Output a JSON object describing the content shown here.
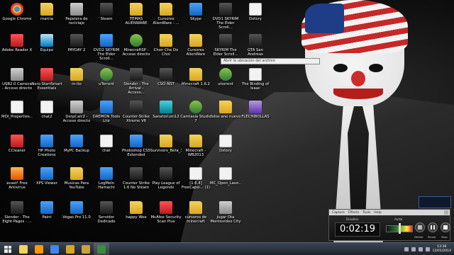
{
  "desktop": {
    "icons": [
      {
        "label": "Google Chrome",
        "icon": "chrome-icon",
        "type": "g-chrome"
      },
      {
        "label": "marcia",
        "icon": "folder-icon",
        "type": "g-folder"
      },
      {
        "label": "Papelera de reciclaje",
        "icon": "recycle-bin-icon",
        "type": "g-gray"
      },
      {
        "label": "Steam",
        "icon": "steam-icon",
        "type": "g-dark"
      },
      {
        "label": "TEMAS ALIENWARE",
        "icon": "folder-icon",
        "type": "g-folder"
      },
      {
        "label": "Cursores AlienWare - ...",
        "icon": "folder-icon",
        "type": "g-folder"
      },
      {
        "label": "Skype",
        "icon": "skype-icon",
        "type": "g-blue"
      },
      {
        "label": "DVD1 SKYRIM The Elder Scroll...",
        "icon": "skyrim-icon",
        "type": "g-dark"
      },
      {
        "label": "Dxtory",
        "icon": "document-icon",
        "type": "g-doc"
      },
      {
        "label": "Adobe Reader X",
        "icon": "adobe-reader-icon",
        "type": "g-red"
      },
      {
        "label": "Equipo",
        "icon": "computer-icon",
        "type": "g-pc"
      },
      {
        "label": "PAYDAY 2",
        "icon": "payday-icon",
        "type": "g-dark"
      },
      {
        "label": "DVD2 SKYRIM The Elder Scroll...",
        "icon": "skyrim-icon",
        "type": "g-blue"
      },
      {
        "label": "MinecraftSP - Acceso directo",
        "icon": "minecraft-icon",
        "type": "g-green"
      },
      {
        "label": "Chon Che Do Choi",
        "icon": "folder-icon",
        "type": "g-folder"
      },
      {
        "label": "Cursores AlienWare",
        "icon": "folder-icon",
        "type": "g-folder"
      },
      {
        "label": "SKYRIM The Elder Scroll...",
        "icon": "skyrim-icon",
        "type": "g-dark"
      },
      {
        "label": "GTA San Andreas",
        "icon": "gta-icon",
        "type": "g-dark"
      },
      {
        "label": "USB2.0 Camera - Acceso directo",
        "icon": "camera-icon",
        "type": "g-gray"
      },
      {
        "label": "Nero StartSmart Essentials",
        "icon": "nero-icon",
        "type": "g-red"
      },
      {
        "label": "m-ito",
        "icon": "folder-icon",
        "type": "g-folder"
      },
      {
        "label": "uTorrent",
        "icon": "utorrent-icon",
        "type": "g-green"
      },
      {
        "label": "Slender - The Arrival - Acceso...",
        "icon": "slender-icon",
        "type": "g-dark"
      },
      {
        "label": "CSO-NST",
        "icon": "counter-strike-icon",
        "type": "g-dark"
      },
      {
        "label": "Minecraft 1.6.2",
        "icon": "folder-icon",
        "type": "g-folder"
      },
      {
        "label": "utorrent",
        "icon": "utorrent-icon",
        "type": "g-green"
      },
      {
        "label": "The Binding of Isaac",
        "icon": "document-icon",
        "type": "g-doc"
      },
      {
        "label": "MOI_Properties...",
        "icon": "document-icon",
        "type": "g-doc"
      },
      {
        "label": "chat2",
        "icon": "document-icon",
        "type": "g-doc"
      },
      {
        "label": "DerpCalc2 - Acceso directo",
        "icon": "derp-icon",
        "type": "g-gray"
      },
      {
        "label": "DAEMON Tools Lite",
        "icon": "daemon-tools-icon",
        "type": "g-blue"
      },
      {
        "label": "Counter-Strike Xtreme V6",
        "icon": "counter-strike-icon",
        "type": "g-dark"
      },
      {
        "label": "Sanatorium12",
        "icon": "sanatorium-icon",
        "type": "g-teal"
      },
      {
        "label": "Camtasia Studio 7",
        "icon": "camtasia-icon",
        "type": "g-green"
      },
      {
        "label": "fotos ano nuevo",
        "icon": "folder-icon",
        "type": "g-folder"
      },
      {
        "label": "FLECHIBOLLAS",
        "icon": "flag-icon",
        "type": "g-purple"
      },
      {
        "label": "CCleaner",
        "icon": "ccleaner-icon",
        "type": "g-red"
      },
      {
        "label": "HP Photo Creations",
        "icon": "hp-icon",
        "type": "g-blue"
      },
      {
        "label": "MyPC Backup",
        "icon": "backup-icon",
        "type": "g-blue"
      },
      {
        "label": "char",
        "icon": "document-icon",
        "type": "g-doc"
      },
      {
        "label": "Photoshop CS5 Extended",
        "icon": "photoshop-icon",
        "type": "g-blue"
      },
      {
        "label": "Survivers_Beta_3",
        "icon": "folder-icon",
        "type": "g-folder"
      },
      {
        "label": "Minecraft - WB2013",
        "icon": "folder-icon",
        "type": "g-folder"
      },
      {
        "label": "Dxtory",
        "icon": "document-icon",
        "type": "g-doc"
      },
      {
        "label": "avast! Free Antivirus",
        "icon": "avast-icon",
        "type": "g-orange"
      },
      {
        "label": "XPS Viewer",
        "icon": "xps-icon",
        "type": "g-blue"
      },
      {
        "label": "Musicas Para YouTube",
        "icon": "folder-icon",
        "type": "g-folder"
      },
      {
        "label": "LogMeIn Hamachi",
        "icon": "hamachi-icon",
        "type": "g-blue"
      },
      {
        "label": "Counter Strike 1.6 No Steam",
        "icon": "counter-strike-icon",
        "type": "g-dark"
      },
      {
        "label": "Play League of Legends",
        "icon": "lol-icon",
        "type": "g-dark"
      },
      {
        "label": "[1.6.4] FreeCapsi... (1)",
        "icon": "document-icon",
        "type": "g-doc"
      },
      {
        "label": "MC_Open_Laun...",
        "icon": "document-icon",
        "type": "g-doc"
      },
      {
        "label": "Slender - The Eight Pages - ...",
        "icon": "slender-icon",
        "type": "g-dark"
      },
      {
        "label": "Paint",
        "icon": "paint-icon",
        "type": "g-blue"
      },
      {
        "label": "Vegas Pro 11.0",
        "icon": "vegas-icon",
        "type": "g-blue"
      },
      {
        "label": "Servidor Dedicado",
        "icon": "server-icon",
        "type": "g-dark"
      },
      {
        "label": "happy Wee",
        "icon": "folder-icon",
        "type": "g-folder"
      },
      {
        "label": "McAfee Security Scan Plus",
        "icon": "mcafee-icon",
        "type": "g-red"
      },
      {
        "label": "cursores de minecraft",
        "icon": "folder-icon",
        "type": "g-folder"
      },
      {
        "label": "Jugar Ota Montevideo City",
        "icon": "game-icon",
        "type": "g-gray"
      }
    ]
  },
  "tooltip": {
    "text": "Abrir la ubicación del archivo"
  },
  "recorder": {
    "menu": [
      "Capture",
      "Effects",
      "Tools",
      "Help"
    ],
    "duration_label": "Duration",
    "audio_label": "Audio",
    "timer": "0:02:19",
    "delete_label": "Delete",
    "pause_label": "Pause",
    "stop_label": "Stop"
  },
  "taskbar": {
    "apps": [
      {
        "icon": "explorer-icon",
        "color": "#f4d35e"
      },
      {
        "icon": "media-player-icon",
        "color": "#ff9800"
      },
      {
        "icon": "chrome-icon",
        "color": "#4285f4"
      },
      {
        "icon": "folder-icon",
        "color": "#d9a621"
      },
      {
        "icon": "lol-icon",
        "color": "#c9a33a"
      },
      {
        "icon": "camtasia-icon",
        "color": "#3b8b3b"
      }
    ],
    "clock": {
      "time": "13:36",
      "date": "12/01/2014"
    }
  }
}
